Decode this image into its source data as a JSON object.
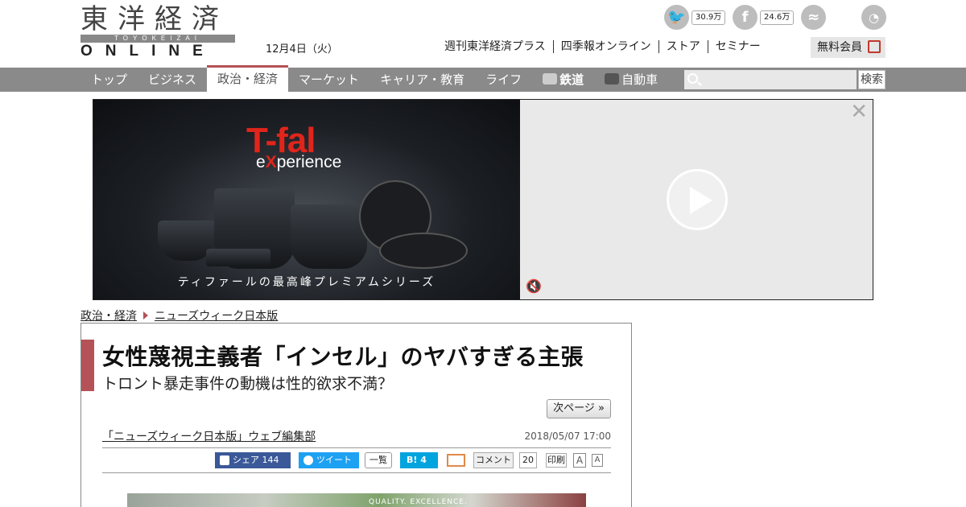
{
  "header": {
    "logo_kanji": "東洋経済",
    "logo_band": "TOYOKEIZAI",
    "logo_online": "ONLINE",
    "date": "12月4日（火）",
    "twitter_count": "30.9万",
    "facebook_count": "24.6万",
    "top_links": [
      "週刊東洋経済プラス",
      "四季報オンライン",
      "ストア",
      "セミナー"
    ],
    "member_label": "無料会員"
  },
  "nav": {
    "items": [
      "トップ",
      "ビジネス",
      "政治・経済",
      "マーケット",
      "キャリア・教育",
      "ライフ",
      "鉄道",
      "自動車"
    ],
    "search_button": "検索"
  },
  "ad": {
    "brand": "T-fal",
    "experience_pre": "e",
    "experience_x": "X",
    "experience_post": "perience",
    "tagline": "ティファールの最高峰プレミアムシリーズ",
    "close": "✕"
  },
  "breadcrumb": {
    "section": "政治・経済",
    "subsection": "ニューズウィーク日本版"
  },
  "article": {
    "title": "女性蔑視主義者「インセル」のヤバすぎる主張",
    "subtitle": "トロント暴走事件の動機は性的欲求不満？",
    "next_page": "次ページ »",
    "author": "「ニューズウィーク日本版」ウェブ編集部",
    "timestamp": "2018/05/07 17:00",
    "share": {
      "facebook": "シェア 144",
      "tweet": "ツイート",
      "list": "一覧",
      "hatena": "B! 4",
      "comment": "コメント",
      "comment_count": "20",
      "print": "印刷",
      "font_large": "A",
      "font_small": "A"
    },
    "photo_text": "QUALITY. EXCELLENCE."
  },
  "colors": {
    "accent": "#b45257",
    "nav_bg": "#8a8a8a",
    "tfal_red": "#e1251b"
  }
}
